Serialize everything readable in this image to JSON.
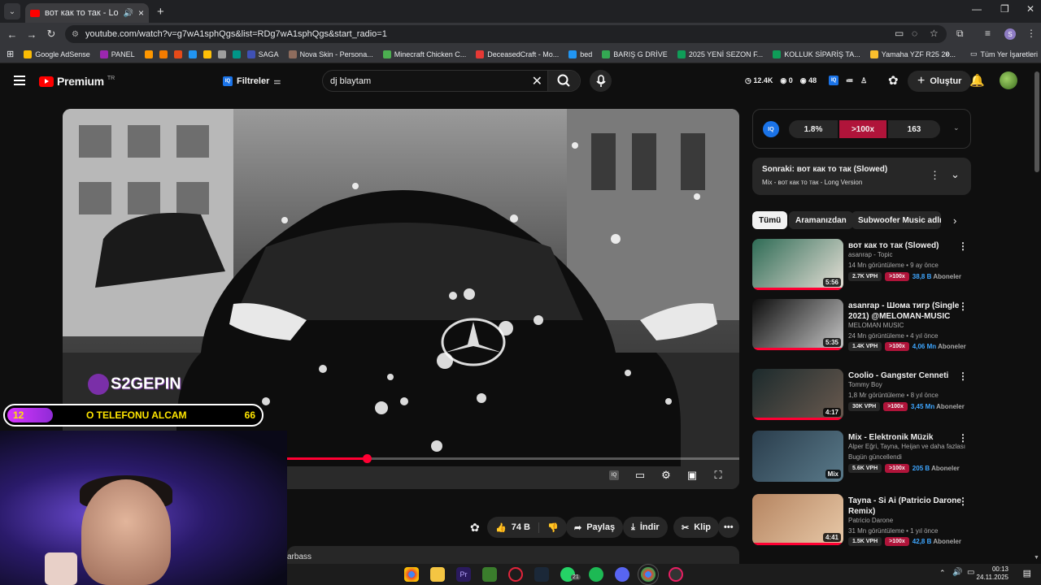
{
  "browser": {
    "tab_title": "вот как то так - Long Version",
    "new_tab": "+",
    "url": "youtube.com/watch?v=g7wA1sphQgs&list=RDg7wA1sphQgs&start_radio=1",
    "bookmarks": [
      {
        "label": "Google AdSense",
        "color": "#fbbc04"
      },
      {
        "label": "PANEL",
        "color": "#9c27b0"
      },
      {
        "label": "",
        "color": "#ff9800"
      },
      {
        "label": "",
        "color": "#f57c00"
      },
      {
        "label": "",
        "color": "#e64a19"
      },
      {
        "label": "",
        "color": "#2196f3"
      },
      {
        "label": "",
        "color": "#ffc107"
      },
      {
        "label": "",
        "color": "#9e9e9e"
      },
      {
        "label": "",
        "color": "#009688"
      },
      {
        "label": "SAGA",
        "color": "#3f51b5"
      },
      {
        "label": "Nova Skin - Persona...",
        "color": "#8e6c5d"
      },
      {
        "label": "Minecraft Chicken C...",
        "color": "#4caf50"
      },
      {
        "label": "DeceasedCraft - Mo...",
        "color": "#e53935"
      },
      {
        "label": "bed",
        "color": "#2196f3"
      },
      {
        "label": "BARIŞ G DRİVE",
        "color": "#34a853"
      },
      {
        "label": "2025 YENİ SEZON F...",
        "color": "#0f9d58"
      },
      {
        "label": "KOLLUK SİPARİŞ TA...",
        "color": "#0f9d58"
      },
      {
        "label": "Yamaha YZF R25 20...",
        "color": "#fbc02d"
      }
    ],
    "all_bookmarks": "Tüm Yer İşaretleri",
    "profile": "S"
  },
  "yt": {
    "logo": "Premium",
    "region": "TR",
    "filter": "Filtreler",
    "search_value": "dj blaytam",
    "stats": {
      "views": "12.4K",
      "a": "0",
      "b": "48"
    },
    "create": "Oluştur"
  },
  "video": {
    "progress": 0.45
  },
  "overlay": {
    "tag": "S2GEPIN",
    "left_num": "12",
    "title": "O TELEFONU ALCAM",
    "right_num": "66"
  },
  "actions": {
    "likes": "74 B",
    "share": "Paylaş",
    "download": "İndir",
    "clip": "Klip",
    "desc_snippet": "arbass"
  },
  "iq": {
    "logo": "IQ",
    "seg1": "1.8%",
    "seg2": ">100x",
    "seg3": "163"
  },
  "next": {
    "title": "Sonraki: вот как то так (Slowed)",
    "sub": "Mix - вот как то так - Long Version"
  },
  "chips": [
    "Tümü",
    "Aramanızdan",
    "Subwoofer Music adlı yü"
  ],
  "recs": [
    {
      "title": "вот как то так (Slowed)",
      "channel": "asanrap - Topic",
      "meta": "14 Mn görüntüleme • 9 ay önce",
      "vph": "2.7K VPH",
      "x": ">100x",
      "subs": "38,8 B",
      "subs_label": "Aboneler",
      "dur": "5:56",
      "c1": "#2e6b55",
      "c2": "#e8e1d8"
    },
    {
      "title": "asanrap -  Шома тигр (Single 2021) @MELOMAN-MUSIC",
      "channel": "MELOMAN MUSIC",
      "meta": "24 Mn görüntüleme • 4 yıl önce",
      "vph": "1.4K VPH",
      "x": ">100x",
      "subs": "4,06 Mn",
      "subs_label": "Aboneler",
      "dur": "5:35",
      "c1": "#0d0d0d",
      "c2": "#c8c8c8"
    },
    {
      "title": "Coolio - Gangster Cenneti",
      "channel": "Tommy Boy",
      "meta": "1,8 Mr görüntüleme • 8 yıl önce",
      "vph": "30K VPH",
      "x": ">100x",
      "subs": "3,45 Mn",
      "subs_label": "Aboneler",
      "dur": "4:17",
      "c1": "#1c2a2c",
      "c2": "#6a5a4f"
    },
    {
      "title": "Mix - Elektronik Müzik",
      "channel": "Alper Eğri, Tayna, Heijan ve daha fazlası",
      "meta": "Bugün güncellendi",
      "vph": "5.6K VPH",
      "x": ">100x",
      "subs": "205 B",
      "subs_label": "Aboneler",
      "dur": "Mix",
      "c1": "#2a3d4c",
      "c2": "#5a7a8a"
    },
    {
      "title": "Tayna - Si Ai (Patricio Darone Remix)",
      "channel": "Patricio Darone",
      "meta": "31 Mn görüntüleme • 1 yıl önce",
      "vph": "1.5K VPH",
      "x": ">100x",
      "subs": "42,8 B",
      "subs_label": "Aboneler",
      "dur": "4:41",
      "c1": "#b58460",
      "c2": "#e8c9a8"
    }
  ],
  "taskbar": {
    "time": "00:13",
    "date": "24.11.2025",
    "badge": "21"
  }
}
